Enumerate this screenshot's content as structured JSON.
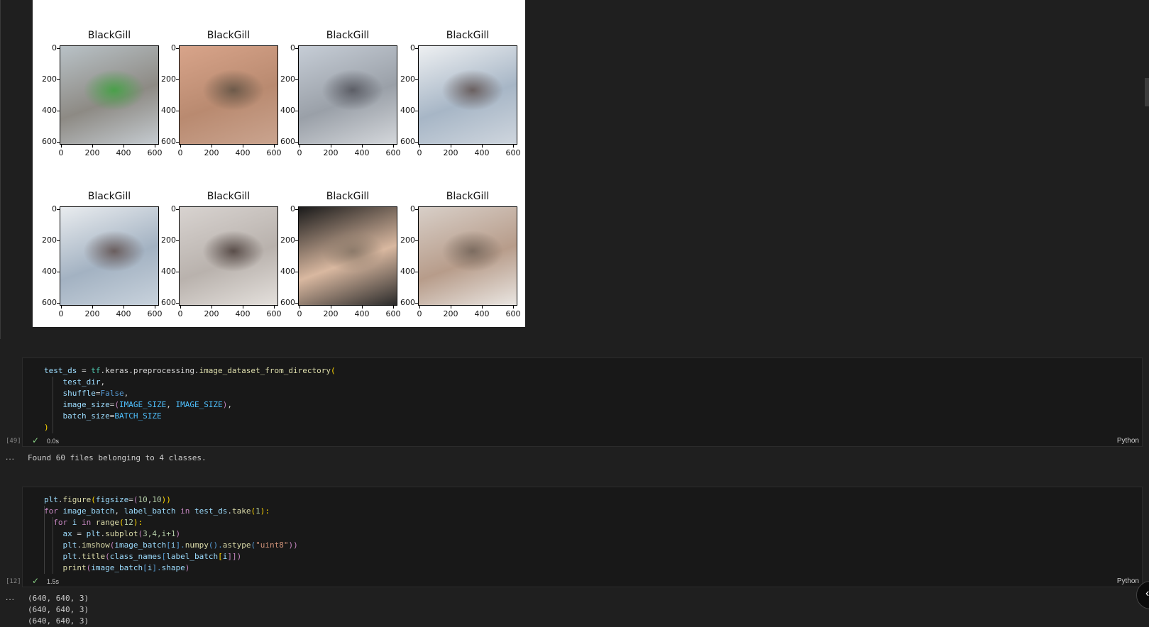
{
  "figure": {
    "subplots": [
      {
        "title": "BlackGill",
        "img_colors": [
          "#b9c2c7",
          "#8d8a84",
          "#4aa04a",
          "#c5cbd0"
        ]
      },
      {
        "title": "BlackGill",
        "img_colors": [
          "#d8a48a",
          "#b98a70",
          "#6d5a4a",
          "#caa48f"
        ]
      },
      {
        "title": "BlackGill",
        "img_colors": [
          "#c6cdd6",
          "#9aa0a8",
          "#5c5e66",
          "#d4d7db"
        ]
      },
      {
        "title": "BlackGill",
        "img_colors": [
          "#eef0f2",
          "#a7b6c6",
          "#6a6060",
          "#cfd6de"
        ]
      },
      {
        "title": "BlackGill",
        "img_colors": [
          "#e9ecef",
          "#a3b2c2",
          "#6a5e5e",
          "#c8d2dc"
        ]
      },
      {
        "title": "BlackGill",
        "img_colors": [
          "#d8d3d0",
          "#b9b2ad",
          "#5a4e4a",
          "#e4e0dc"
        ]
      },
      {
        "title": "BlackGill",
        "img_colors": [
          "#1a1a1a",
          "#d9b8a0",
          "#8c7a6a",
          "#2a2a2a"
        ]
      },
      {
        "title": "BlackGill",
        "img_colors": [
          "#d8cfc8",
          "#b79c8a",
          "#7c6c60",
          "#eae6e2"
        ]
      }
    ],
    "yticks": [
      "0",
      "200",
      "400",
      "600"
    ],
    "xticks": [
      "0",
      "200",
      "400",
      "600"
    ]
  },
  "cell1": {
    "exec_count": "[49]",
    "duration": "0.0s",
    "language": "Python",
    "output_dots": "...",
    "output": "Found 60 files belonging to 4 classes."
  },
  "cell2": {
    "exec_count": "[12]",
    "duration": "1.5s",
    "language": "Python",
    "output_dots": "...",
    "output_lines": [
      "(640, 640, 3)",
      "(640, 640, 3)",
      "(640, 640, 3)"
    ]
  },
  "code1": {
    "l1a": "test_ds",
    "l1b": " = ",
    "l1c": "tf",
    "l1d": ".keras.preprocessing.",
    "l1e": "image_dataset_from_directory",
    "l1f": "(",
    "l2a": "    test_dir",
    "l2b": ",",
    "l3a": "    shuffle",
    "l3b": "=",
    "l3c": "False",
    "l3d": ",",
    "l4a": "    image_size",
    "l4b": "=",
    "l4c": "(",
    "l4d": "IMAGE_SIZE",
    "l4e": ", ",
    "l4f": "IMAGE_SIZE",
    "l4g": ")",
    "l4h": ",",
    "l5a": "    batch_size",
    "l5b": "=",
    "l5c": "BATCH_SIZE",
    "l6a": ")"
  },
  "code2": {
    "l1a": "plt",
    "l1b": ".",
    "l1c": "figure",
    "l1d": "(",
    "l1e": "figsize",
    "l1f": "=",
    "l1g": "(",
    "l1h": "10",
    "l1i": ",",
    "l1j": "10",
    "l1k": "))",
    "l2a": "for",
    "l2b": " image_batch",
    "l2c": ", ",
    "l2d": "label_batch",
    "l2e": " in ",
    "l2f": "test_ds",
    "l2g": ".",
    "l2h": "take",
    "l2i": "(",
    "l2j": "1",
    "l2k": "):",
    "l3a": "  for",
    "l3b": " i",
    "l3c": " in ",
    "l3d": "range",
    "l3e": "(",
    "l3f": "12",
    "l3g": "):",
    "l4a": "    ax",
    "l4b": " = ",
    "l4c": "plt",
    "l4d": ".",
    "l4e": "subplot",
    "l4f": "(",
    "l4g": "3,4,i+1",
    "l4h": ")",
    "l5a": "    plt",
    "l5b": ".",
    "l5c": "imshow",
    "l5d": "(",
    "l5e": "image_batch",
    "l5f": "[",
    "l5g": "i",
    "l5h": "].",
    "l5i": "numpy",
    "l5j": "().",
    "l5k": "astype",
    "l5l": "(",
    "l5m": "\"uint8\"",
    "l5n": "))",
    "l6a": "    plt",
    "l6b": ".",
    "l6c": "title",
    "l6d": "(",
    "l6e": "class_names",
    "l6f": "[",
    "l6g": "label_batch",
    "l6h": "[",
    "l6i": "i",
    "l6j": "]])",
    "l7a": "    print",
    "l7b": "(",
    "l7c": "image_batch",
    "l7d": "[",
    "l7e": "i",
    "l7f": "].",
    "l7g": "shape",
    "l7h": ")"
  },
  "fab_icon": "chevron-left-icon"
}
